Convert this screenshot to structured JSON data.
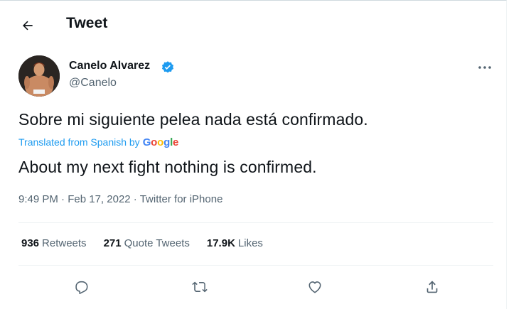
{
  "header": {
    "title": "Tweet"
  },
  "tweet": {
    "author_name": "Canelo Alvarez",
    "author_handle": "@Canelo",
    "original_text": "Sobre mi siguiente pelea nada está confirmado.",
    "translated_from": "Translated from Spanish by",
    "translation_provider": "Google",
    "translation_text": "About my next fight nothing is confirmed.",
    "time": "9:49 PM",
    "date": "Feb 17, 2022",
    "source": "Twitter for iPhone"
  },
  "stats": {
    "retweets_count": "936",
    "retweets_label": "Retweets",
    "quotes_count": "271",
    "quotes_label": "Quote Tweets",
    "likes_count": "17.9K",
    "likes_label": "Likes"
  },
  "icons": {
    "back": "back-arrow-icon",
    "verified": "verified-badge-icon",
    "more": "more-dots-icon",
    "reply": "reply-icon",
    "retweet": "retweet-icon",
    "like": "like-icon",
    "share": "share-icon"
  },
  "colors": {
    "text": "#0f1419",
    "secondary": "#536471",
    "accent": "#1d9bf0",
    "divider": "#eff3f4"
  }
}
